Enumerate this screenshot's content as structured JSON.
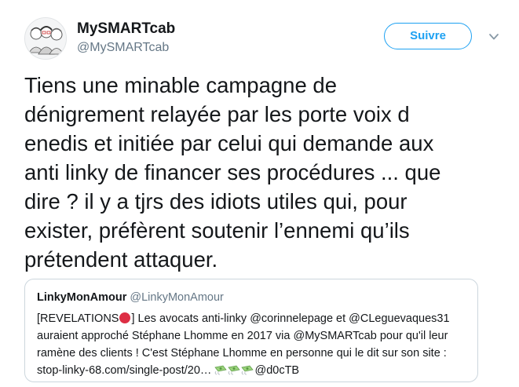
{
  "author": {
    "display_name": "MySMARTcab",
    "handle": "@MySMARTcab",
    "avatar_icon": "avatar-illustration"
  },
  "follow_button": {
    "label": "Suivre",
    "color": "#1da1f2"
  },
  "menu_icon": "chevron-down-icon",
  "tweet": {
    "lines": [
      "Tiens une minable campagne de",
      "dénigrement relayée par les porte voix d",
      "enedis et initiée par celui qui demande aux",
      "anti linky de financer ses procédures ... que",
      "dire ? il y a tjrs des idiots utiles qui, pour",
      "exister, préfèrent soutenir l’ennemi qu’ils",
      "prétendent attaquer."
    ]
  },
  "quoted_tweet": {
    "display_name": "LinkyMonAmour",
    "handle": "@LinkyMonAmour",
    "line1_before_emoji": "[REVELATIONS",
    "line1_after_emoji": "] Les avocats anti-linky @corinnelepage et @CLeguevaques31",
    "line2": "auraient approché Stéphane Lhomme en 2017 via @MySMARTcab pour qu'il leur",
    "line3": "ramène des clients ! C'est Stéphane Lhomme en personne qui le dit sur son site :",
    "line4_link": "stop-linky-68.com/single-post/20…",
    "line4_mention": "@d0cTB",
    "emoji_red_circle": "red-circle-emoji",
    "emoji_money": "money-with-wings-emoji",
    "money_emoji_count": 3
  },
  "colors": {
    "text": "#14171a",
    "secondary": "#657786",
    "border": "#ccd6dd",
    "red_circle": "#dd2e44",
    "money_green": "#9bd37c"
  }
}
